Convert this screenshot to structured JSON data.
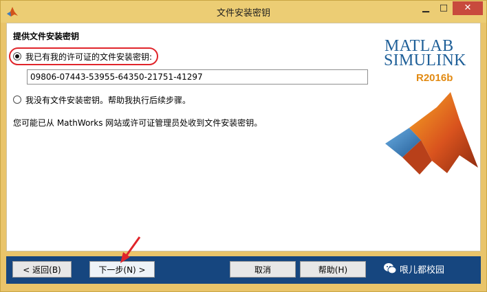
{
  "window": {
    "title": "文件安装密钥",
    "minimize_glyph": "▁",
    "maximize_glyph": "□",
    "close_glyph": "✕"
  },
  "content": {
    "heading": "提供文件安装密钥",
    "option_have_key": "我已有我的许可证的文件安装密钥:",
    "key_value": "09806-07443-53955-64350-21751-41297",
    "option_no_key": "我没有文件安装密钥。帮助我执行后续步骤。",
    "info_text": "您可能已从 MathWorks 网站或许可证管理员处收到文件安装密钥。"
  },
  "logo": {
    "line1": "MATLAB",
    "line2": "SIMULINK",
    "release": "R2016b"
  },
  "buttons": {
    "back": "< 返回(B)",
    "next": "下一步(N) >",
    "cancel": "取消",
    "help": "帮助(H)"
  },
  "watermark": {
    "text": "哏儿都校园"
  },
  "colors": {
    "titlebar": "#eccd74",
    "bottombar": "#16467f",
    "highlight_ring": "#e0242a",
    "close_button": "#c84a3d"
  },
  "icons": [
    "matlab-app-icon",
    "matlab-membrane-logo",
    "wechat-icon",
    "annotation-arrow"
  ]
}
